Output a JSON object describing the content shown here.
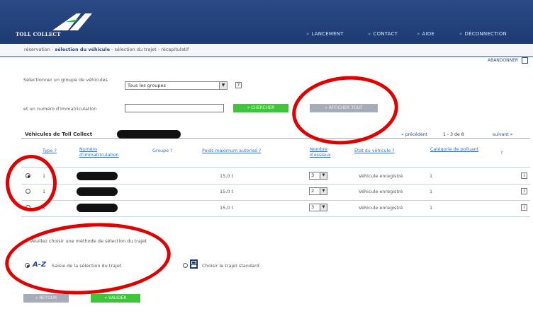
{
  "header": {
    "logo_text": "TOLL COLLECT",
    "nav": [
      {
        "label": "LANCEMENT"
      },
      {
        "label": "CONTACT"
      },
      {
        "label": "AIDE"
      },
      {
        "label": "DÉCONNECTION"
      }
    ]
  },
  "breadcrumb": {
    "step1": "réservation",
    "sep": "-",
    "step2": "sélection du véhicule",
    "step3": "sélection du trajet",
    "step4": "récapitulatif"
  },
  "abandon_label": "ABANDONNER",
  "form": {
    "group_label": "Sélectionner un groupe de véhicules",
    "group_value": "Tous les groupes",
    "help_glyph": "?",
    "plate_label": "et un numéro d'immatriculation",
    "plate_value": "",
    "search_button": "» CHERCHER",
    "all_button": "» AFFICHER TOUT"
  },
  "table": {
    "title": "Véhicules de Toll Collect",
    "pager": {
      "prev": "« précédent",
      "range": "1 - 3 de 8",
      "next": "suivant »"
    },
    "columns": [
      {
        "label": "Type ?"
      },
      {
        "label": "Numéro d'immatriculation"
      },
      {
        "label": "Groupe ?"
      },
      {
        "label": "Poids maximum autorisé ?"
      },
      {
        "label": "Nombre d'essieux"
      },
      {
        "label": "État du véhicule ?"
      },
      {
        "label": "Catégorie de polluant"
      },
      {
        "label": "?"
      }
    ],
    "rows": [
      {
        "selected": true,
        "type": "1",
        "weight": "15,0 t",
        "axles": "3",
        "status": "Véhicule enregistré",
        "pollutant": "1",
        "info": "i"
      },
      {
        "selected": false,
        "type": "1",
        "weight": "15,0 t",
        "axles": "2",
        "status": "Véhicule enregistré",
        "pollutant": "1",
        "info": "i"
      },
      {
        "selected": false,
        "type": "1",
        "weight": "15,0 t",
        "axles": "3",
        "status": "Véhicule enregistré",
        "pollutant": "1",
        "info": "i"
      }
    ]
  },
  "method": {
    "prompt": "Veuillez choisir une méthode de sélection du trajet",
    "option1_badge": "A-Z",
    "option1_label": "Saisie de la sélection du trajet",
    "option2_label": "Choisir le trajet standard"
  },
  "footer": {
    "back_button": "« RETOUR",
    "next_button": "» VALIDER"
  },
  "colors": {
    "header_blue": "#1d3a72",
    "green_button": "#3ec53a",
    "grey_button": "#a7acb9",
    "annotation_red": "#e00000"
  }
}
